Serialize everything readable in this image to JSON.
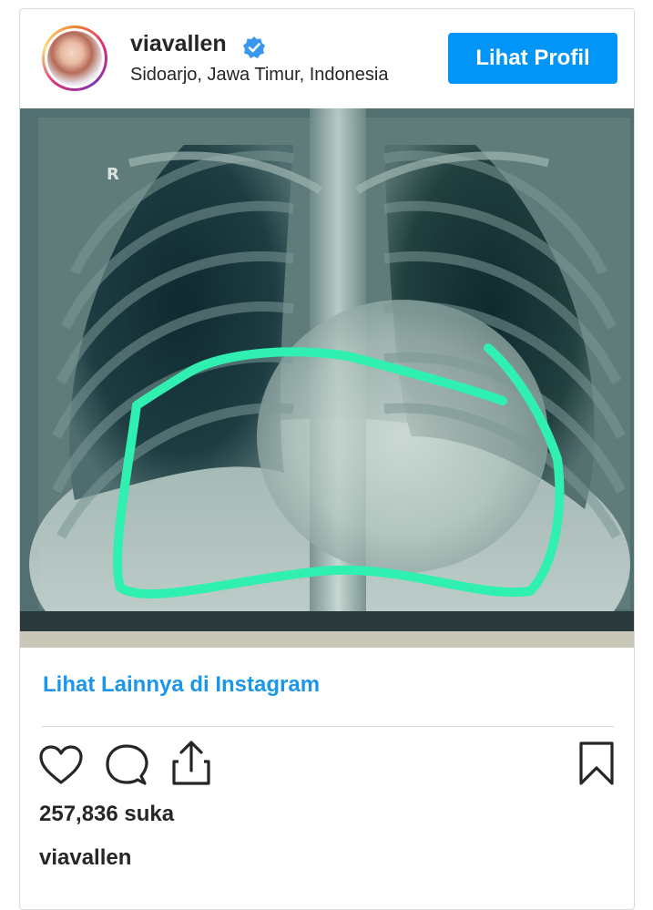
{
  "post": {
    "username": "viavallen",
    "location": "Sidoarjo, Jawa Timur, Indonesia",
    "profile_button": "Lihat Profil",
    "see_more_link": "Lihat Lainnya di Instagram",
    "likes": "257,836 suka",
    "caption_username": "viavallen"
  },
  "image": {
    "film_marker": "R"
  },
  "icons": {
    "verified": "verified-badge-icon",
    "like": "heart-icon",
    "comment": "comment-bubble-icon",
    "share": "share-upload-icon",
    "save": "bookmark-icon"
  },
  "colors": {
    "accent": "#0095f6",
    "link": "#1c96e8",
    "highlight_stroke": "#2ff0b0",
    "text": "#262626"
  }
}
